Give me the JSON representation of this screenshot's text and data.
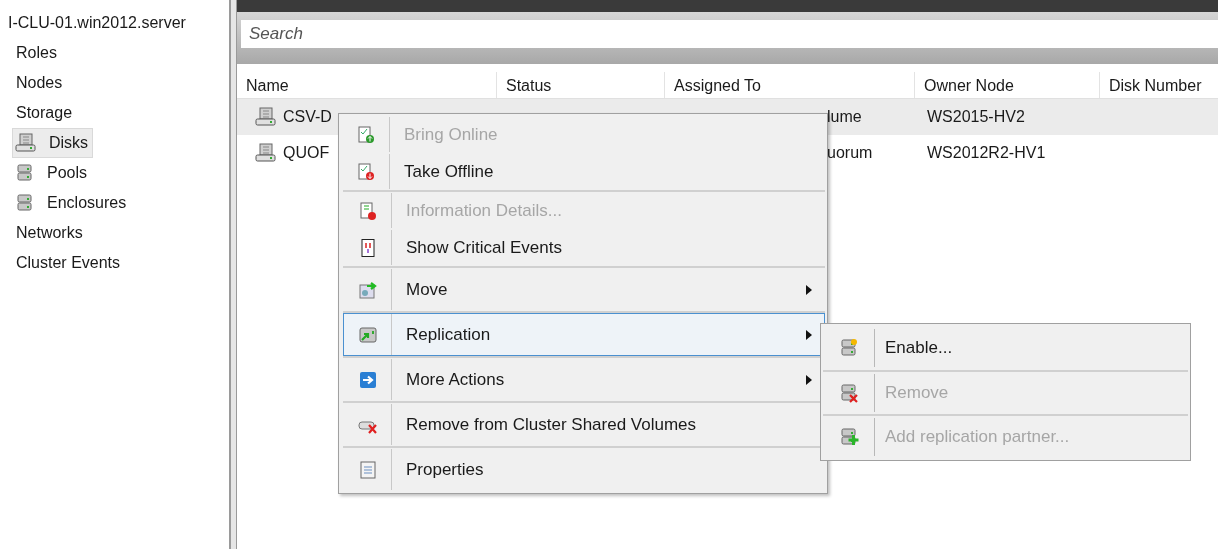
{
  "tree": {
    "label": "I-CLU-01.win2012.server",
    "children": [
      {
        "label": "Roles",
        "selected": false
      },
      {
        "label": "Nodes",
        "selected": false
      },
      {
        "label": "Storage",
        "selected": false,
        "children": [
          {
            "label": "Disks",
            "selected": true
          },
          {
            "label": "Pools",
            "selected": false
          },
          {
            "label": "Enclosures",
            "selected": false
          }
        ]
      },
      {
        "label": "Networks",
        "selected": false
      },
      {
        "label": "Cluster Events",
        "selected": false
      }
    ]
  },
  "search": {
    "placeholder": "Search"
  },
  "table": {
    "columns": [
      "Name",
      "Status",
      "Assigned To",
      "Owner Node",
      "Disk Number"
    ],
    "rows": [
      {
        "selected": true,
        "cells": [
          "CSV-D",
          "",
          "lume",
          "WS2015-HV2",
          ""
        ]
      },
      {
        "selected": false,
        "cells": [
          "QUOF",
          "",
          "uorum",
          "WS2012R2-HV1",
          ""
        ]
      }
    ]
  },
  "context_menu": {
    "groups": [
      [
        {
          "label": "Bring Online",
          "disabled": true,
          "submenu": false,
          "selected": false
        },
        {
          "label": "Take Offline",
          "disabled": false,
          "submenu": false,
          "selected": false
        }
      ],
      [
        {
          "label": "Information Details...",
          "disabled": true,
          "submenu": false,
          "selected": false
        },
        {
          "label": "Show Critical Events",
          "disabled": false,
          "submenu": false,
          "selected": false
        }
      ],
      [
        {
          "label": "Move",
          "disabled": false,
          "submenu": true,
          "selected": false
        }
      ],
      [
        {
          "label": "Replication",
          "disabled": false,
          "submenu": true,
          "selected": true
        }
      ],
      [
        {
          "label": "More Actions",
          "disabled": false,
          "submenu": true,
          "selected": false
        }
      ],
      [
        {
          "label": "Remove from Cluster Shared Volumes",
          "disabled": false,
          "submenu": false,
          "selected": false
        }
      ],
      [
        {
          "label": "Properties",
          "disabled": false,
          "submenu": false,
          "selected": false
        }
      ]
    ]
  },
  "submenu": {
    "items": [
      {
        "label": "Enable...",
        "disabled": false
      },
      {
        "label": "Remove",
        "disabled": true
      },
      {
        "label": "Add replication partner...",
        "disabled": true
      }
    ]
  }
}
